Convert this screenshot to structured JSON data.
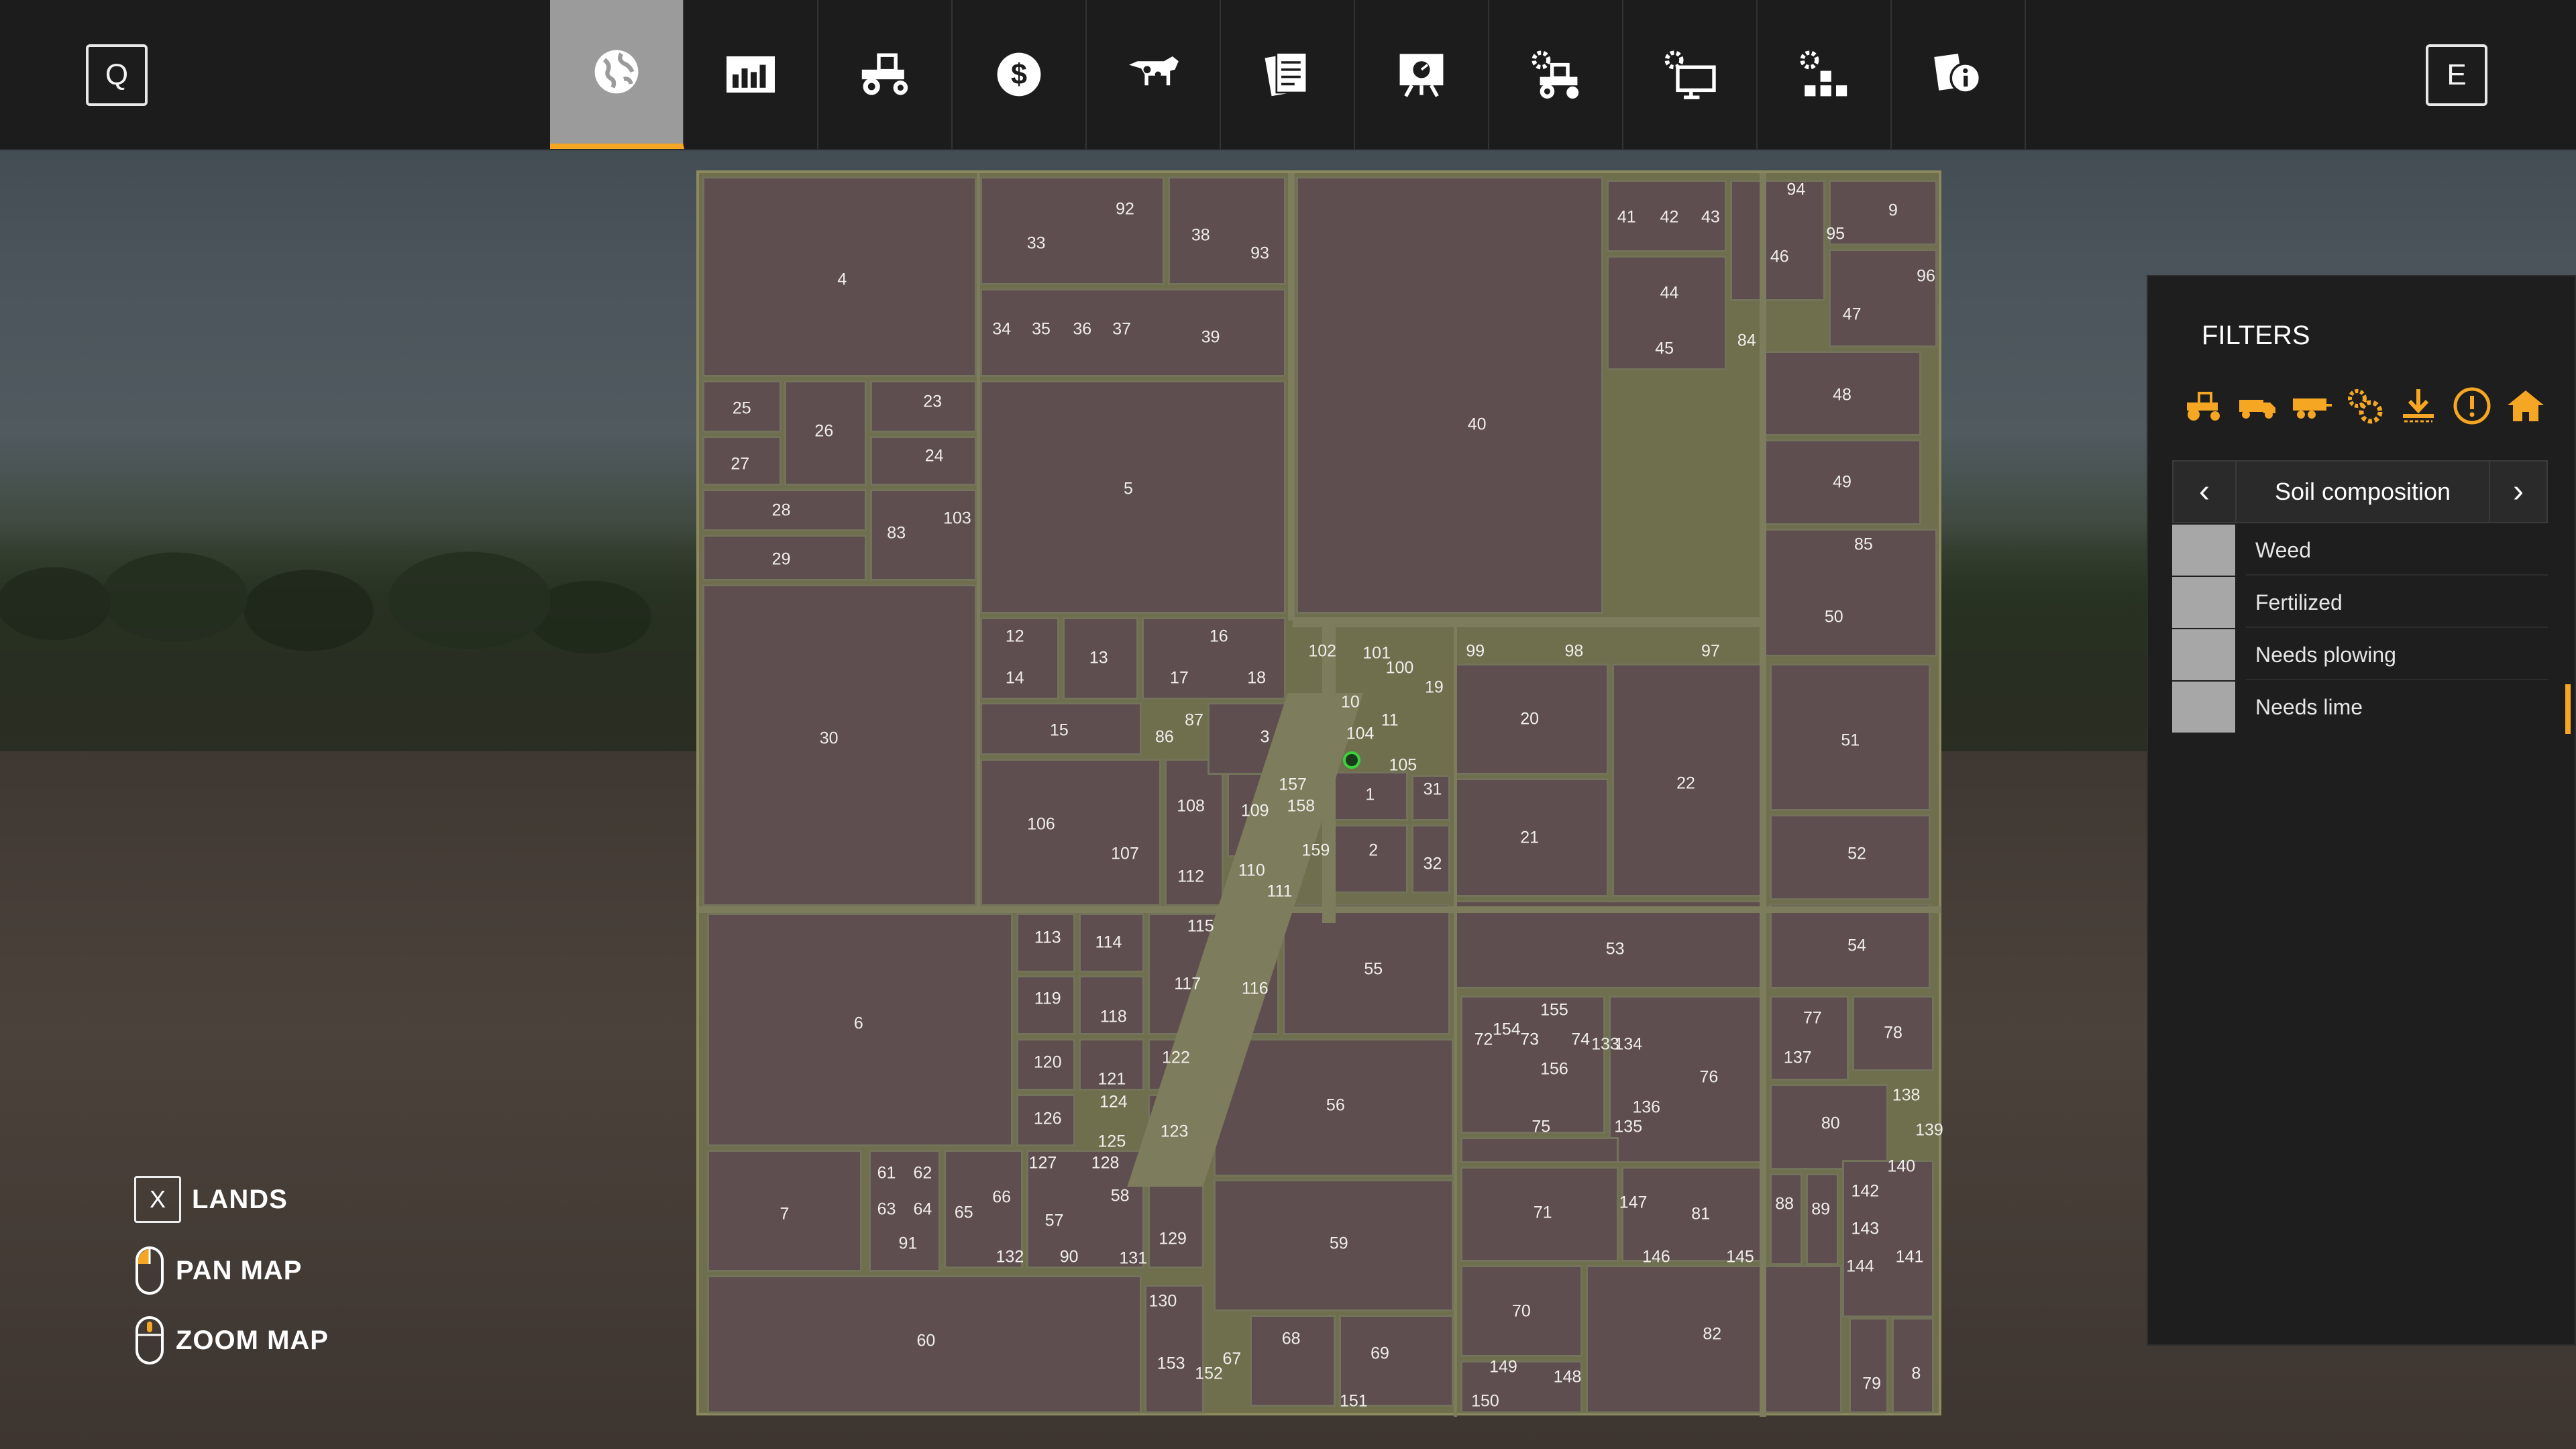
{
  "topbar": {
    "left_key": "Q",
    "right_key": "E",
    "tabs": [
      {
        "icon": "globe-icon",
        "active": true
      },
      {
        "icon": "statistics-chart-icon",
        "active": false
      },
      {
        "icon": "tractor-icon",
        "active": false
      },
      {
        "icon": "money-icon",
        "active": false
      },
      {
        "icon": "cow-icon",
        "active": false
      },
      {
        "icon": "contracts-icon",
        "active": false
      },
      {
        "icon": "presentation-icon",
        "active": false
      },
      {
        "icon": "vehicle-settings-icon",
        "active": false
      },
      {
        "icon": "screen-settings-icon",
        "active": false
      },
      {
        "icon": "production-icon",
        "active": false
      },
      {
        "icon": "help-info-icon",
        "active": false
      }
    ]
  },
  "filters": {
    "title": "FILTERS",
    "icons": [
      "tractor-filter-icon",
      "truck-filter-icon",
      "trailer-filter-icon",
      "tools-filter-icon",
      "sell-point-filter-icon",
      "warning-filter-icon",
      "farmhouse-filter-icon"
    ],
    "accent_color": "#f5a623",
    "selector": {
      "label": "Soil composition",
      "prev": "‹",
      "next": "›"
    },
    "legend": [
      {
        "label": "Weed"
      },
      {
        "label": "Fertilized"
      },
      {
        "label": "Needs plowing"
      },
      {
        "label": "Needs lime"
      }
    ]
  },
  "hints": {
    "lands_key": "X",
    "lands": "LANDS",
    "pan": "PAN MAP",
    "zoom": "ZOOM MAP"
  },
  "map": {
    "field_labels": [
      "1",
      "2",
      "3",
      "4",
      "5",
      "6",
      "7",
      "8",
      "9",
      "10",
      "11",
      "12",
      "13",
      "14",
      "15",
      "16",
      "17",
      "18",
      "19",
      "20",
      "21",
      "22",
      "23",
      "24",
      "25",
      "26",
      "27",
      "28",
      "29",
      "30",
      "31",
      "32",
      "33",
      "34",
      "35",
      "36",
      "37",
      "38",
      "39",
      "40",
      "41",
      "42",
      "43",
      "44",
      "45",
      "46",
      "47",
      "48",
      "49",
      "50",
      "51",
      "52",
      "53",
      "54",
      "55",
      "56",
      "57",
      "58",
      "59",
      "60",
      "61",
      "62",
      "63",
      "64",
      "65",
      "66",
      "67",
      "68",
      "69",
      "70",
      "71",
      "72",
      "73",
      "74",
      "75",
      "76",
      "77",
      "78",
      "79",
      "80",
      "81",
      "82",
      "83",
      "84",
      "85",
      "86",
      "87",
      "88",
      "89",
      "90",
      "91",
      "92",
      "93",
      "94",
      "95",
      "96",
      "97",
      "98",
      "99",
      "100",
      "101",
      "102",
      "103",
      "104",
      "105",
      "106",
      "107",
      "108",
      "109",
      "110",
      "111",
      "112",
      "113",
      "114",
      "115",
      "116",
      "117",
      "118",
      "119",
      "120",
      "121",
      "122",
      "123",
      "124",
      "125",
      "126",
      "127",
      "128",
      "129",
      "130",
      "131",
      "132",
      "133",
      "134",
      "135",
      "136",
      "137",
      "138",
      "139",
      "140",
      "141",
      "142",
      "143",
      "144",
      "145",
      "146",
      "147",
      "148",
      "149",
      "150",
      "151",
      "152",
      "153",
      "154",
      "155",
      "156",
      "157",
      "158",
      "159"
    ]
  }
}
